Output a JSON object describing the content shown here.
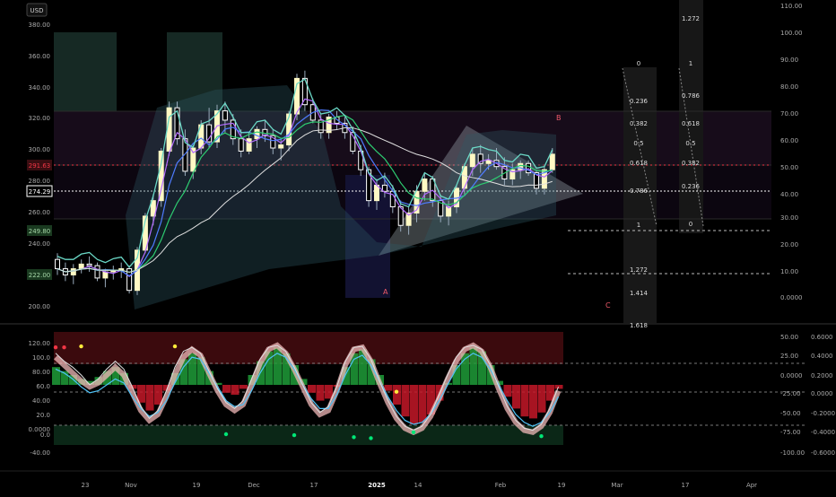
{
  "chart_data": [
    {
      "type": "candlestick",
      "currency": "USD",
      "left_axis": {
        "ticks": [
          "380.00",
          "360.00",
          "340.00",
          "320.00",
          "300.00",
          "280.00",
          "260.00",
          "240.00",
          "200.00"
        ]
      },
      "right_axis": {
        "ticks": [
          "110.00",
          "100.00",
          "90.00",
          "80.00",
          "70.00",
          "60.00",
          "50.00",
          "40.00",
          "30.00",
          "20.00",
          "10.00",
          "0.0000"
        ]
      },
      "price_labels": [
        {
          "text": "291.63",
          "color": "#f23645"
        },
        {
          "text": "274.29",
          "color": "#ffffff"
        },
        {
          "text": "249.80",
          "color": "#a5d6a7"
        },
        {
          "text": "222.00",
          "color": "#a5d6a7"
        }
      ],
      "fib_left": [
        "0",
        "0.236",
        "0.382",
        "0.5",
        "0.618",
        "0.786",
        "1",
        "1.272",
        "1.414",
        "1.618"
      ],
      "fib_right": [
        "1.272",
        "1",
        "0.786",
        "0.618",
        "0.5",
        "0.382",
        "0.236",
        "0"
      ],
      "annotations": [
        "A",
        "B",
        "C"
      ],
      "candles": [
        [
          228,
          232,
          218,
          222
        ],
        [
          222,
          226,
          214,
          218
        ],
        [
          218,
          225,
          212,
          222
        ],
        [
          222,
          228,
          219,
          225
        ],
        [
          225,
          230,
          220,
          224
        ],
        [
          224,
          226,
          214,
          216
        ],
        [
          216,
          222,
          210,
          220
        ],
        [
          220,
          224,
          215,
          221
        ],
        [
          221,
          226,
          216,
          222
        ],
        [
          222,
          224,
          206,
          208
        ],
        [
          208,
          236,
          205,
          234
        ],
        [
          234,
          258,
          232,
          256
        ],
        [
          256,
          270,
          250,
          266
        ],
        [
          266,
          300,
          262,
          298
        ],
        [
          298,
          330,
          295,
          326
        ],
        [
          326,
          330,
          302,
          306
        ],
        [
          306,
          312,
          282,
          285
        ],
        [
          285,
          302,
          280,
          300
        ],
        [
          300,
          318,
          296,
          315
        ],
        [
          315,
          326,
          300,
          304
        ],
        [
          304,
          328,
          300,
          324
        ],
        [
          324,
          330,
          310,
          318
        ],
        [
          318,
          322,
          302,
          306
        ],
        [
          306,
          312,
          294,
          298
        ],
        [
          298,
          310,
          296,
          306
        ],
        [
          306,
          314,
          300,
          312
        ],
        [
          312,
          318,
          304,
          308
        ],
        [
          308,
          312,
          296,
          300
        ],
        [
          300,
          306,
          292,
          302
        ],
        [
          302,
          324,
          298,
          322
        ],
        [
          322,
          348,
          318,
          345
        ],
        [
          345,
          350,
          324,
          328
        ],
        [
          328,
          332,
          316,
          318
        ],
        [
          318,
          322,
          306,
          310
        ],
        [
          310,
          322,
          306,
          320
        ],
        [
          320,
          324,
          312,
          316
        ],
        [
          316,
          320,
          306,
          310
        ],
        [
          310,
          314,
          296,
          298
        ],
        [
          298,
          302,
          282,
          286
        ],
        [
          286,
          288,
          262,
          266
        ],
        [
          266,
          280,
          260,
          276
        ],
        [
          276,
          284,
          268,
          272
        ],
        [
          272,
          276,
          258,
          262
        ],
        [
          262,
          266,
          246,
          250
        ],
        [
          250,
          262,
          244,
          258
        ],
        [
          258,
          276,
          252,
          272
        ],
        [
          272,
          284,
          266,
          280
        ],
        [
          280,
          282,
          262,
          266
        ],
        [
          266,
          270,
          252,
          256
        ],
        [
          256,
          266,
          250,
          262
        ],
        [
          262,
          276,
          258,
          274
        ],
        [
          274,
          290,
          270,
          288
        ],
        [
          288,
          300,
          282,
          296
        ],
        [
          296,
          302,
          284,
          290
        ],
        [
          290,
          296,
          286,
          292
        ],
        [
          292,
          300,
          286,
          288
        ],
        [
          288,
          294,
          276,
          280
        ],
        [
          280,
          290,
          276,
          286
        ],
        [
          286,
          292,
          280,
          290
        ],
        [
          290,
          292,
          282,
          284
        ],
        [
          284,
          286,
          270,
          274
        ],
        [
          274,
          288,
          270,
          286
        ],
        [
          286,
          300,
          284,
          296
        ]
      ]
    },
    {
      "type": "oscillator",
      "left_axis": {
        "ticks": [
          "120.00",
          "100.0",
          "80.00",
          "60.0",
          "40.00",
          "20.0",
          "0.0000",
          "0.0",
          "-40.00"
        ]
      },
      "right_axis_1": {
        "ticks": [
          "50.00",
          "25.00",
          "0.0000",
          "-25.00",
          "-50.00",
          "-75.00",
          "-100.00"
        ]
      },
      "right_axis_2": {
        "ticks": [
          "0.6000",
          "0.4000",
          "0.2000",
          "0.0000",
          "-0.2000",
          "-0.4000",
          "-0.6000"
        ]
      },
      "series": [
        {
          "values": [
            88,
            80,
            72,
            64,
            58,
            62,
            70,
            78,
            70,
            52,
            34,
            24,
            30,
            48,
            70,
            88,
            96,
            90,
            72,
            54,
            40,
            34,
            40,
            60,
            82,
            96,
            100,
            92,
            76,
            58,
            40,
            30,
            34,
            54,
            80,
            96,
            98,
            84,
            62,
            42,
            26,
            16,
            12,
            16,
            28,
            46,
            66,
            84,
            96,
            100,
            94,
            78,
            56,
            36,
            22,
            14,
            12,
            18,
            32,
            54
          ]
        },
        {
          "values": [
            76,
            72,
            66,
            58,
            52,
            54,
            60,
            66,
            62,
            48,
            36,
            28,
            32,
            44,
            62,
            78,
            88,
            86,
            72,
            58,
            44,
            38,
            40,
            54,
            72,
            86,
            92,
            88,
            76,
            60,
            46,
            36,
            36,
            50,
            70,
            86,
            90,
            80,
            64,
            48,
            34,
            24,
            20,
            22,
            30,
            44,
            60,
            76,
            86,
            92,
            88,
            76,
            60,
            44,
            30,
            22,
            18,
            22,
            32,
            48
          ]
        },
        {
          "values": [
            92,
            84,
            78,
            70,
            60,
            66,
            76,
            84,
            76,
            58,
            38,
            26,
            34,
            54,
            78,
            94,
            98,
            92,
            74,
            56,
            42,
            36,
            44,
            66,
            86,
            98,
            100,
            94,
            78,
            60,
            42,
            32,
            38,
            58,
            84,
            98,
            99,
            86,
            64,
            44,
            28,
            18,
            14,
            18,
            30,
            50,
            70,
            88,
            98,
            100,
            96,
            80,
            58,
            38,
            24,
            16,
            14,
            20,
            36,
            58
          ]
        }
      ],
      "hist": [
        18,
        14,
        10,
        6,
        4,
        8,
        14,
        18,
        12,
        -4,
        -18,
        -26,
        -20,
        -6,
        12,
        26,
        32,
        28,
        14,
        2,
        -8,
        -10,
        -4,
        10,
        24,
        34,
        38,
        32,
        20,
        6,
        -8,
        -16,
        -14,
        -2,
        18,
        32,
        36,
        26,
        10,
        -6,
        -20,
        -32,
        -40,
        -38,
        -30,
        -16,
        2,
        20,
        32,
        38,
        34,
        20,
        4,
        -12,
        -24,
        -32,
        -34,
        -28,
        -16,
        -4
      ],
      "dots": [
        {
          "x": 3,
          "y": 99,
          "c": "#ffeb3b"
        },
        {
          "x": 14,
          "y": 99,
          "c": "#ffeb3b"
        },
        {
          "x": 42,
          "y": 12,
          "c": "#00e676"
        },
        {
          "x": 20,
          "y": 10,
          "c": "#00e676"
        },
        {
          "x": 28,
          "y": 9,
          "c": "#00e676"
        },
        {
          "x": 35,
          "y": 7,
          "c": "#00e676"
        },
        {
          "x": 37,
          "y": 6,
          "c": "#00e676"
        },
        {
          "x": 40,
          "y": 53,
          "c": "#ffeb3b"
        },
        {
          "x": 57,
          "y": 8,
          "c": "#00e676"
        },
        {
          "x": 0,
          "y": 98,
          "c": "#f23645"
        },
        {
          "x": 1,
          "y": 98,
          "c": "#f23645"
        }
      ]
    }
  ],
  "time_axis": {
    "labels": [
      "23",
      "Nov",
      "19",
      "Dec",
      "17",
      "2025",
      "14",
      "Feb",
      "19",
      "Mar",
      "17",
      "Apr"
    ]
  },
  "colors": {
    "up": "#fff9c4",
    "down": "#ffffff",
    "support": "#a5d6a7",
    "resistance": "#f23645"
  }
}
